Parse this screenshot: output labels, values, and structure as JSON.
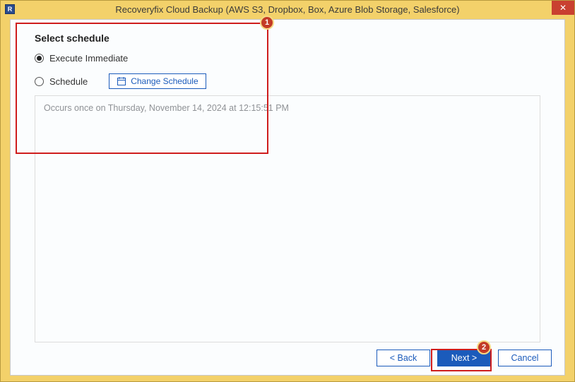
{
  "window": {
    "title": "Recoveryfix Cloud Backup (AWS S3, Dropbox, Box, Azure Blob Storage, Salesforce)",
    "close_symbol": "✕"
  },
  "section": {
    "title": "Select schedule",
    "radio_execute": "Execute Immediate",
    "radio_schedule": "Schedule",
    "change_btn": "Change Schedule",
    "info_text": "Occurs once on Thursday, November 14, 2024 at 12:15:51 PM",
    "selected": "execute"
  },
  "annotations": {
    "badge1": "1",
    "badge2": "2"
  },
  "buttons": {
    "back": "< Back",
    "next": "Next >",
    "cancel": "Cancel"
  },
  "app_icon_letter": "R"
}
